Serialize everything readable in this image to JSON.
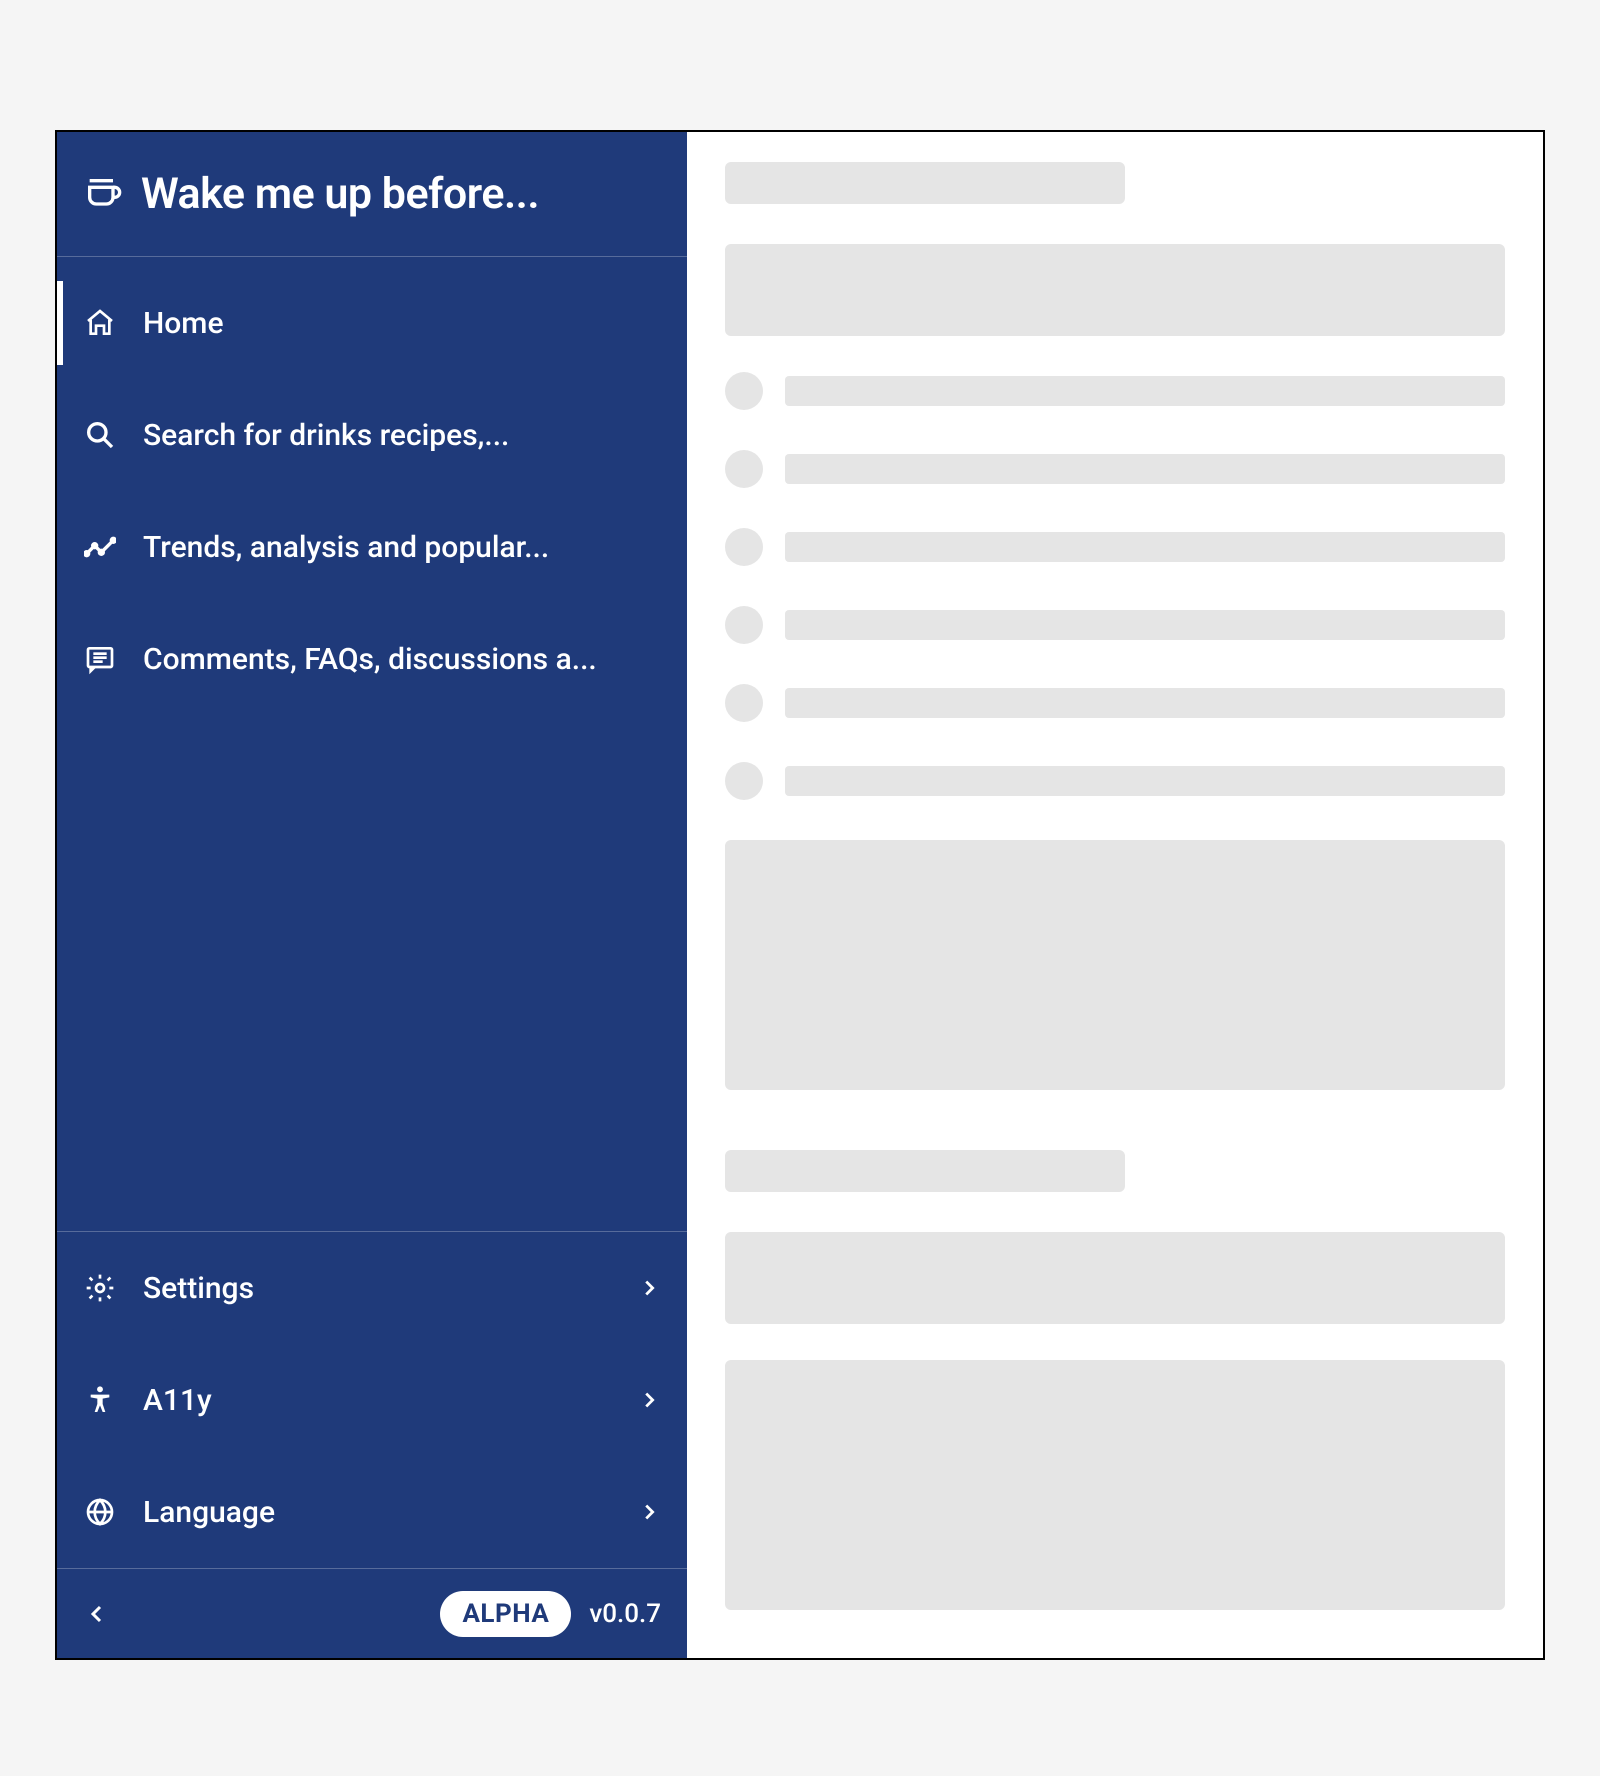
{
  "sidebar": {
    "title": "Wake me up before...",
    "nav_top": [
      {
        "label": "Home",
        "icon": "home-icon",
        "active": true
      },
      {
        "label": "Search for drinks recipes,...",
        "icon": "search-icon",
        "active": false
      },
      {
        "label": "Trends, analysis and popular...",
        "icon": "trends-icon",
        "active": false
      },
      {
        "label": "Comments, FAQs, discussions a...",
        "icon": "comments-icon",
        "active": false
      }
    ],
    "nav_bottom": [
      {
        "label": "Settings",
        "icon": "gear-icon"
      },
      {
        "label": "A11y",
        "icon": "accessibility-icon"
      },
      {
        "label": "Language",
        "icon": "globe-icon"
      }
    ],
    "badge": "ALPHA",
    "version": "v0.0.7"
  }
}
